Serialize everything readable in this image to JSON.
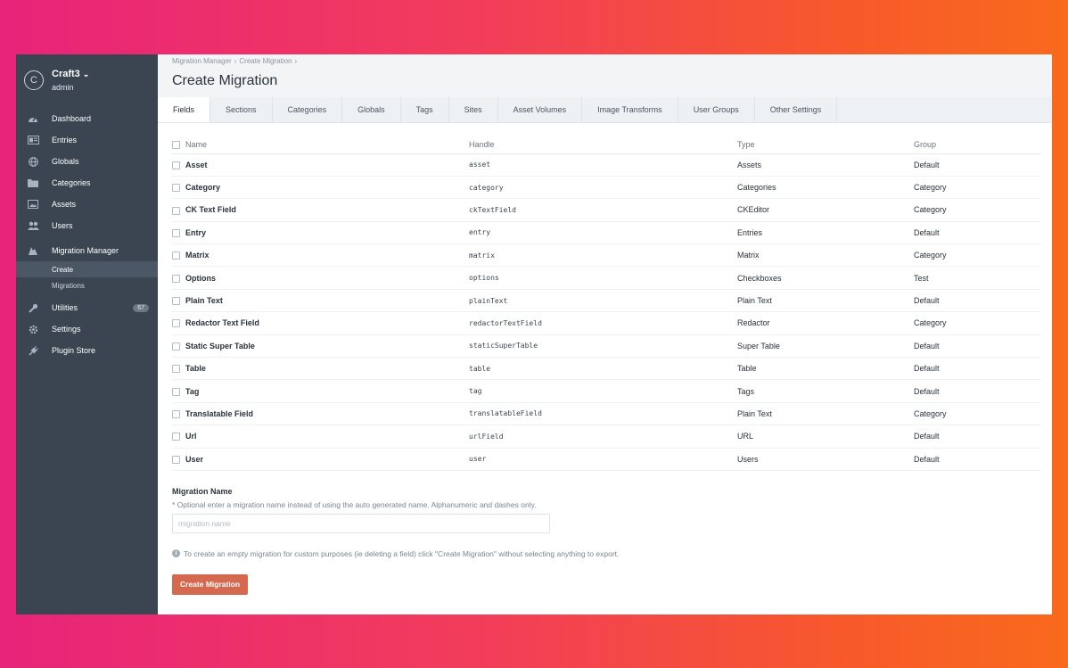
{
  "site": {
    "logo_letter": "C",
    "name": "Craft3",
    "user": "admin"
  },
  "nav": {
    "dashboard": "Dashboard",
    "entries": "Entries",
    "globals": "Globals",
    "categories": "Categories",
    "assets": "Assets",
    "users": "Users",
    "migration_manager": "Migration Manager",
    "sub_create": "Create",
    "sub_migrations": "Migrations",
    "utilities": "Utilities",
    "utilities_badge": "67",
    "settings": "Settings",
    "plugin_store": "Plugin Store"
  },
  "breadcrumbs": {
    "first": "Migration Manager",
    "second": "Create Migration"
  },
  "page_title": "Create Migration",
  "tabs": [
    "Fields",
    "Sections",
    "Categories",
    "Globals",
    "Tags",
    "Sites",
    "Asset Volumes",
    "Image Transforms",
    "User Groups",
    "Other Settings"
  ],
  "table": {
    "headers": {
      "name": "Name",
      "handle": "Handle",
      "type": "Type",
      "group": "Group"
    },
    "rows": [
      {
        "name": "Asset",
        "handle": "asset",
        "type": "Assets",
        "group": "Default"
      },
      {
        "name": "Category",
        "handle": "category",
        "type": "Categories",
        "group": "Category"
      },
      {
        "name": "CK Text Field",
        "handle": "ckTextField",
        "type": "CKEditor",
        "group": "Category"
      },
      {
        "name": "Entry",
        "handle": "entry",
        "type": "Entries",
        "group": "Default"
      },
      {
        "name": "Matrix",
        "handle": "matrix",
        "type": "Matrix",
        "group": "Category"
      },
      {
        "name": "Options",
        "handle": "options",
        "type": "Checkboxes",
        "group": "Test"
      },
      {
        "name": "Plain Text",
        "handle": "plainText",
        "type": "Plain Text",
        "group": "Default"
      },
      {
        "name": "Redactor Text Field",
        "handle": "redactorTextField",
        "type": "Redactor",
        "group": "Category"
      },
      {
        "name": "Static Super Table",
        "handle": "staticSuperTable",
        "type": "Super Table",
        "group": "Default"
      },
      {
        "name": "Table",
        "handle": "table",
        "type": "Table",
        "group": "Default"
      },
      {
        "name": "Tag",
        "handle": "tag",
        "type": "Tags",
        "group": "Default"
      },
      {
        "name": "Translatable Field",
        "handle": "translatableField",
        "type": "Plain Text",
        "group": "Category"
      },
      {
        "name": "Url",
        "handle": "urlField",
        "type": "URL",
        "group": "Default"
      },
      {
        "name": "User",
        "handle": "user",
        "type": "Users",
        "group": "Default"
      }
    ]
  },
  "form": {
    "label": "Migration Name",
    "instructions": "* Optional enter a migration name instead of using the auto generated name. Alphanumeric and dashes only.",
    "input_value": "",
    "input_placeholder": "migration name",
    "info_icon": "i",
    "note": "To create an empty migration for custom purposes (ie deleting a field) click \"Create Migration\" without selecting anything to export.",
    "submit_label": "Create Migration"
  },
  "colors": {
    "sidebar": "#3a4551",
    "accent_button": "#d5694f"
  }
}
